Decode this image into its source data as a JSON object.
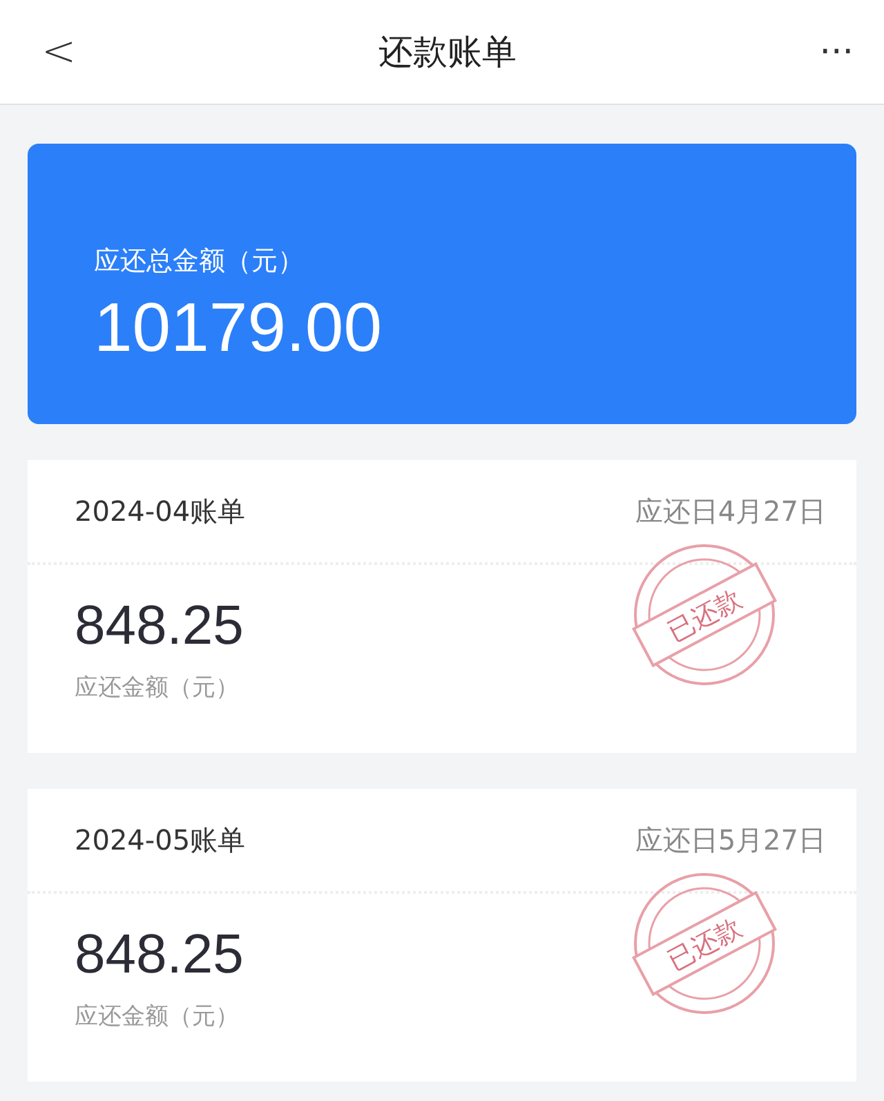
{
  "header": {
    "back": "<",
    "title": "还款账单",
    "more": "···"
  },
  "summary": {
    "label": "应还总金额（元）",
    "amount": "10179.00"
  },
  "bills": [
    {
      "period": "2024-04账单",
      "due": "应还日4月27日",
      "amount": "848.25",
      "amount_label": "应还金额（元）",
      "paid": true,
      "stamp": "已还款"
    },
    {
      "period": "2024-05账单",
      "due": "应还日5月27日",
      "amount": "848.25",
      "amount_label": "应还金额（元）",
      "paid": true,
      "stamp": "已还款"
    }
  ]
}
